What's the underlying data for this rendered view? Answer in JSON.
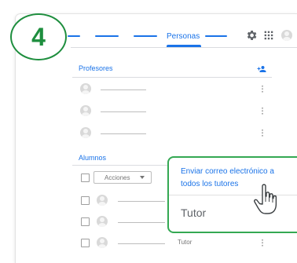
{
  "step": {
    "number": "4"
  },
  "header": {
    "active_tab": "Personas",
    "icons": [
      "settings-gear-icon",
      "apps-grid-icon",
      "account-avatar-icon"
    ]
  },
  "teachers": {
    "title": "Profesores",
    "add_icon": "add-person-icon",
    "rows": [
      {
        "name": "",
        "menu_icon": "more-vert-icon"
      },
      {
        "name": "",
        "menu_icon": "more-vert-icon"
      },
      {
        "name": "",
        "menu_icon": "more-vert-icon"
      }
    ]
  },
  "students": {
    "title": "Alumnos",
    "actions_label": "Acciones",
    "rows": [
      {
        "name": ""
      },
      {
        "name": ""
      },
      {
        "name": "",
        "tag": "Tutor"
      }
    ]
  },
  "popup": {
    "action_label": "Enviar correo electrónico a todos los tutores",
    "section_label": "Tutor"
  },
  "colors": {
    "accent": "#1a73e8",
    "highlight": "#34a853"
  }
}
